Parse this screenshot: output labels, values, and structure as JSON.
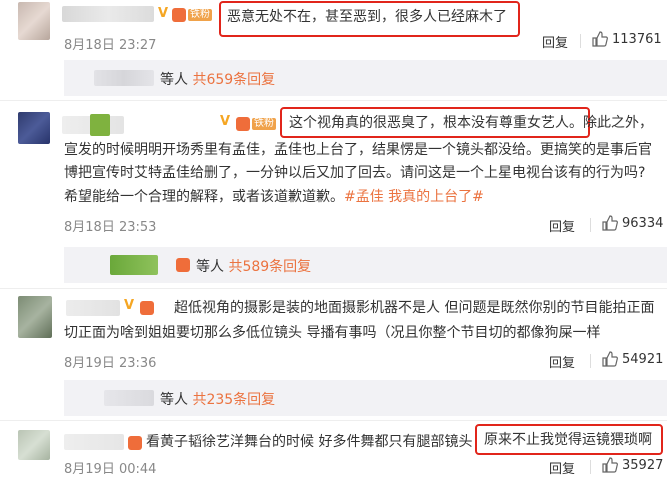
{
  "comments": [
    {
      "text": "恶意无处不在，甚至恶到，很多人已经麻木了",
      "fan_tag": "铁粉",
      "time": "8月18日 23:27",
      "reply_label": "回复",
      "likes": "113761",
      "sub_replies": {
        "prefix": "等人",
        "count": "共659条回复"
      }
    },
    {
      "fan_tag": "铁粉",
      "line1_highlight": "这个视角真的很恶臭了，根本没有尊重女艺人。",
      "line1_rest": "除此之外，",
      "line2": "宣发的时候明明开场秀里有孟佳，孟佳也上台了，结果愣是一个镜头都没给。更搞笑的是事后官",
      "line3": "博把宣传时艾特孟佳给删了，一分钟以后又加了回去。请问这是一个上星电视台该有的行为吗?",
      "line4_plain": "希望能给一个合理的解释，或者该道歉道歉。",
      "line4_topic": "#孟佳 我真的上台了#",
      "time": "8月18日 23:53",
      "reply_label": "回复",
      "likes": "96334",
      "sub_replies": {
        "prefix": "等人",
        "count": "共589条回复"
      }
    },
    {
      "line1": "超低视角的摄影是装的地面摄影机器不是人 但问题是既然你别的节目能拍正面",
      "line2": "切正面为啥到姐姐要切那么多低位镜头 导播有事吗（况且你整个节目切的都像狗屎一样",
      "time": "8月19日 23:36",
      "reply_label": "回复",
      "likes": "54921",
      "sub_replies": {
        "prefix": "等人",
        "count": "共235条回复"
      }
    },
    {
      "text_plain": "看黄子韬徐艺洋舞台的时候 好多件舞都只有腿部镜头",
      "text_highlight": "原来不止我觉得运镜猥琐啊",
      "time": "8月19日 00:44",
      "reply_label": "回复",
      "likes": "35927"
    }
  ],
  "colors": {
    "accent": "#eb7340",
    "highlight_box": "#e1251b",
    "subbar": "#f2f2f5"
  },
  "icons": {
    "like": "thumbs-up-icon",
    "verified": "v-badge-icon",
    "fan": "fan-badge-icon"
  }
}
